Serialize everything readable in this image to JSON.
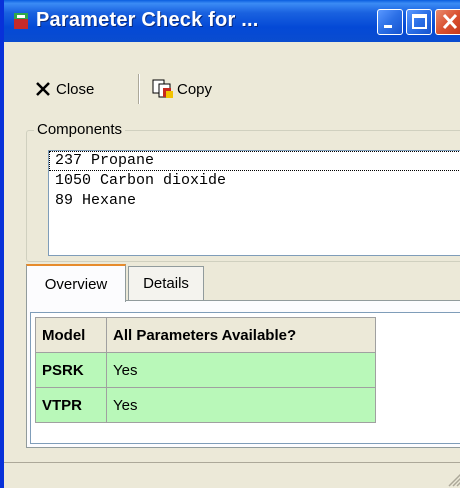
{
  "window": {
    "title": "Parameter Check for ...",
    "buttons": {
      "minimize": "minimize",
      "maximize": "maximize",
      "close": "close"
    }
  },
  "toolbar": {
    "close_label": "Close",
    "copy_label": "Copy"
  },
  "components": {
    "label": "Components",
    "items": [
      "237 Propane",
      "1050 Carbon dioxide",
      "89 Hexane"
    ]
  },
  "tabs": [
    {
      "label": "Overview",
      "active": true
    },
    {
      "label": "Details",
      "active": false
    }
  ],
  "table": {
    "headers": [
      "Model",
      "All Parameters Available?"
    ],
    "rows": [
      {
        "model": "PSRK",
        "available": "Yes"
      },
      {
        "model": "VTPR",
        "available": "Yes"
      }
    ],
    "row_color": "#b9f8b9"
  },
  "colors": {
    "titlebar": "#0449d6",
    "window_bg": "#ece9d8",
    "close_btn": "#d9502f"
  }
}
